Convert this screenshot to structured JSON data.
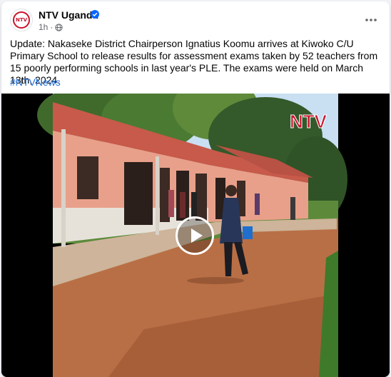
{
  "post": {
    "page_name": "NTV Uganda",
    "avatar_text": "NTV",
    "timestamp": "1h",
    "separator": "·",
    "audience_icon": "globe-icon",
    "verified_icon": "verified-badge-icon",
    "more_icon": "more-options-icon",
    "text": "Update: Nakaseke District Chairperson Ignatius Koomu arrives at Kiwoko C/U Primary School to release results for assessment exams taken by 52 teachers from 15 poorly performing schools in last year's PLE. The exams were held on March 13th, 2024.",
    "hashtag": "#NTVNews"
  },
  "video": {
    "watermark": "NTV",
    "play_icon": "play-icon"
  },
  "colors": {
    "link": "#216fdb",
    "brand_red": "#c9142c",
    "verified": "#0866ff",
    "secondary_text": "#65676b"
  }
}
